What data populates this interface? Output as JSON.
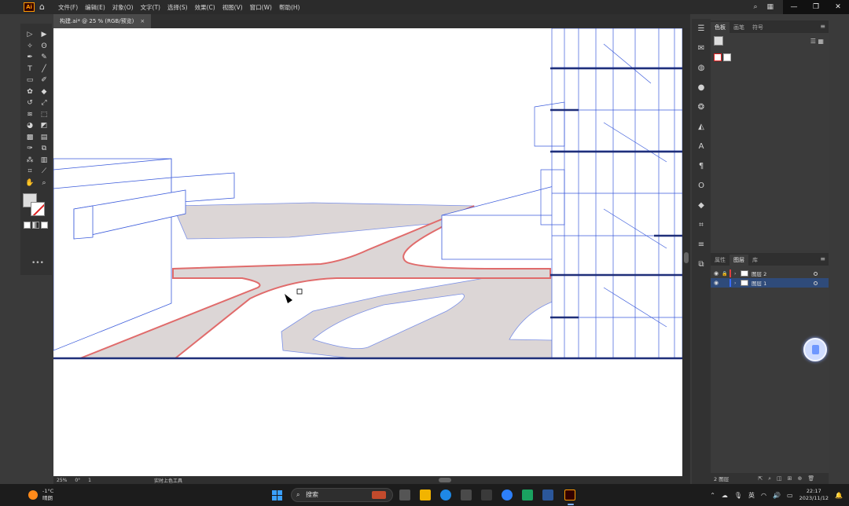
{
  "app": {
    "logo": "Ai",
    "menus": [
      "文件(F)",
      "编辑(E)",
      "对象(O)",
      "文字(T)",
      "选择(S)",
      "效果(C)",
      "视图(V)",
      "窗口(W)",
      "帮助(H)"
    ]
  },
  "document": {
    "tab_title": "构建.ai* @ 25 % (RGB/预览)",
    "close_glyph": "×"
  },
  "status": {
    "zoom": "25%",
    "rotation": "0°",
    "artboard": "1",
    "tool_name": "实时上色工具"
  },
  "panels": {
    "top_tabs": [
      "色板",
      "画笔",
      "符号"
    ],
    "layer_tabs": [
      "属性",
      "图层",
      "库"
    ],
    "layers": [
      {
        "name": "图层 2",
        "color": "#e04040",
        "selected": false
      },
      {
        "name": "图层 1",
        "color": "#3a6cff",
        "selected": true
      }
    ],
    "layer_count": "2 图层"
  },
  "taskbar": {
    "weather_temp": "-1°C",
    "weather_desc": "晴朗",
    "search_placeholder": "搜索",
    "ime": "英",
    "time": "22:17",
    "date": "2023/11/12"
  },
  "colors": {
    "selection_red": "#e06b6b",
    "road_fill": "#dcd6d6",
    "line_blue": "#3b5bdb",
    "dark_blue": "#1f2f7a",
    "accent": "#ff9a00"
  }
}
